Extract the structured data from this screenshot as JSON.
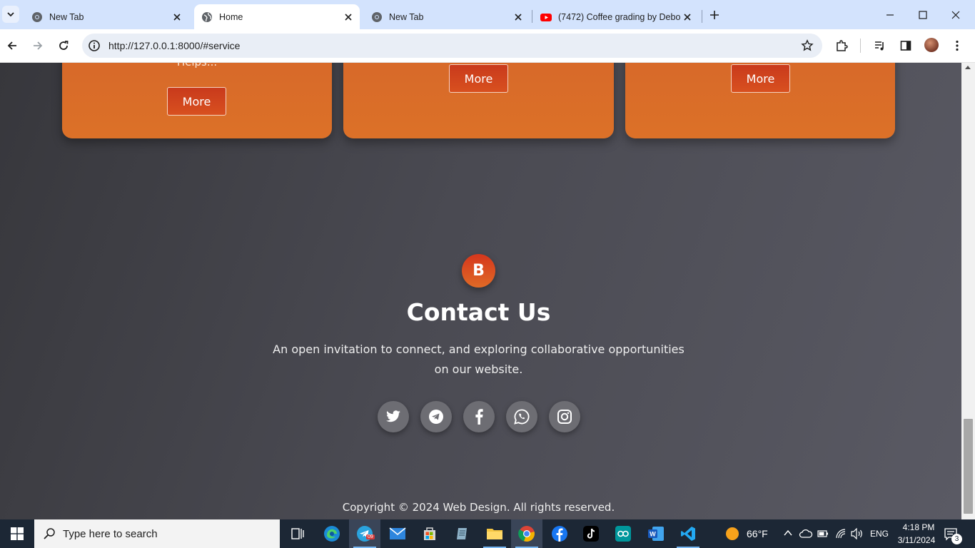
{
  "browser": {
    "tabs": [
      {
        "title": "New Tab",
        "icon": "chrome-icon",
        "active": false
      },
      {
        "title": "Home",
        "icon": "globe-icon",
        "active": true
      },
      {
        "title": "New Tab",
        "icon": "chrome-icon",
        "active": false
      },
      {
        "title": "(7472) Coffee grading by Debo",
        "icon": "youtube-icon",
        "active": false
      }
    ],
    "url": "http://127.0.0.1:8000/#service"
  },
  "services": {
    "card1_text": "Helps...",
    "more_label": "More"
  },
  "contact": {
    "logo_letter": "B",
    "title": "Contact Us",
    "description": "An open invitation to connect, and exploring collaborative opportunities on our website.",
    "socials": [
      "twitter-icon",
      "telegram-icon",
      "facebook-icon",
      "whatsapp-icon",
      "instagram-icon"
    ]
  },
  "footer": {
    "copyright": "Copyright © 2024 Web Design. All rights reserved."
  },
  "taskbar": {
    "search_placeholder": "Type here to search",
    "telegram_badge": "09",
    "weather": "66°F",
    "language": "ENG",
    "time": "4:18 PM",
    "date": "3/11/2024",
    "notifications": "3"
  },
  "colors": {
    "accent": "#dc6b28",
    "button": "#cf4420",
    "page_bg": "#4a4a52"
  }
}
